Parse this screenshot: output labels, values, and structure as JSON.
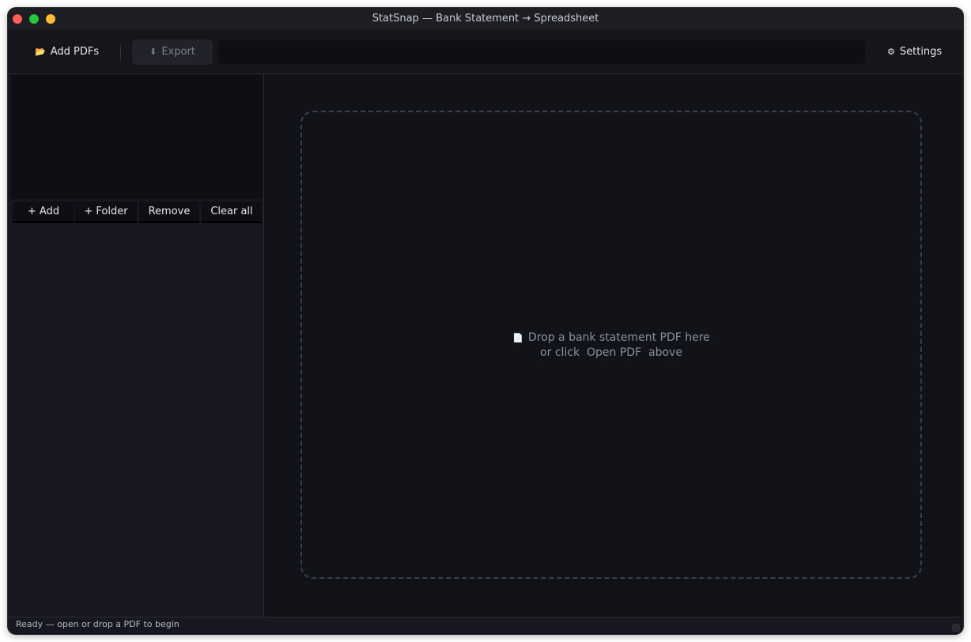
{
  "window": {
    "title": "StatSnap — Bank Statement → Spreadsheet"
  },
  "toolbar": {
    "add_pdfs": {
      "icon": "open-folder-icon",
      "glyph": "📂",
      "label": "Add PDFs"
    },
    "export": {
      "icon": "download-icon",
      "glyph": "⬇",
      "label": "Export"
    },
    "settings": {
      "icon": "gear-icon",
      "glyph": "⚙",
      "label": "Settings"
    }
  },
  "sidebar": {
    "buttons": {
      "add": "+ Add",
      "folder": "+ Folder",
      "remove": "Remove",
      "clear_all": "Clear all"
    }
  },
  "dropzone": {
    "icon": "document-icon",
    "glyph": "📄",
    "line1": "Drop a bank statement PDF here",
    "line2": "or click  Open PDF  above"
  },
  "status": {
    "text": "Ready — open or drop a PDF to begin"
  },
  "colors": {
    "background": "#15161c",
    "panel": "#0e0f14",
    "main": "#121319",
    "dash_border": "#3c3d4c",
    "text": "#e6e7ee",
    "muted_text": "#8d8fa0",
    "close": "#ff5f57",
    "minimize": "#28c840",
    "maximize": "#febc2e"
  }
}
